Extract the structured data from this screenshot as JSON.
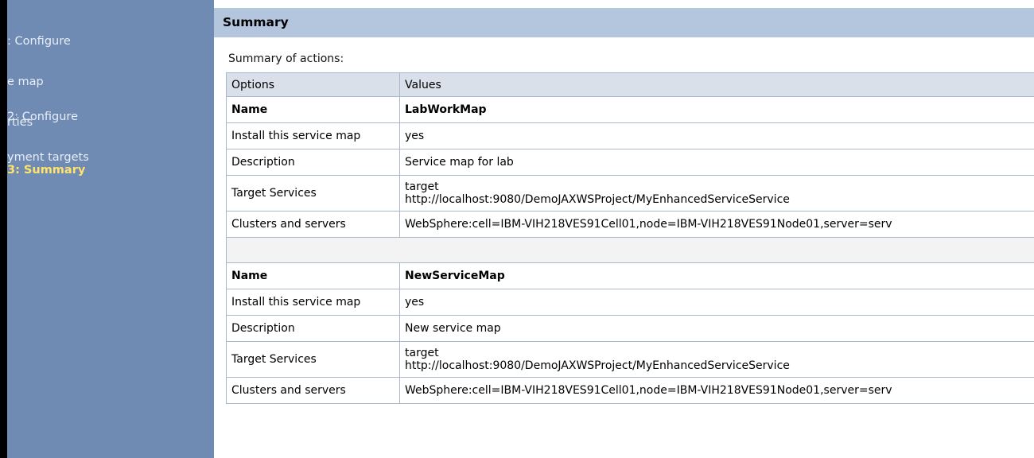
{
  "sidebar": {
    "steps": [
      {
        "line1": ": Configure",
        "line2": "e map",
        "line3": "rties"
      },
      {
        "line1": "2: Configure",
        "line2": "yment targets"
      },
      {
        "line1": "3: Summary"
      }
    ]
  },
  "main": {
    "title": "Summary",
    "caption": "Summary of actions:",
    "table": {
      "headers": [
        "Options",
        "Values"
      ],
      "maps": [
        {
          "name_label": "Name",
          "name": "LabWorkMap",
          "install_label": "Install this service map",
          "install": "yes",
          "description_label": "Description",
          "description": "Service map for lab",
          "targets_label": "Target Services",
          "targets_line1": "target",
          "targets_line2": "http://localhost:9080/DemoJAXWSProject/MyEnhancedServiceService",
          "clusters_label": "Clusters and servers",
          "clusters": "WebSphere:cell=IBM-VIH218VES91Cell01,node=IBM-VIH218VES91Node01,server=serv"
        },
        {
          "name_label": "Name",
          "name": "NewServiceMap",
          "install_label": "Install this service map",
          "install": "yes",
          "description_label": "Description",
          "description": "New service map",
          "targets_label": "Target Services",
          "targets_line1": "target",
          "targets_line2": "http://localhost:9080/DemoJAXWSProject/MyEnhancedServiceService",
          "clusters_label": "Clusters and servers",
          "clusters": "WebSphere:cell=IBM-VIH218VES91Cell01,node=IBM-VIH218VES91Node01,server=serv"
        }
      ]
    }
  },
  "colors": {
    "sidebar_bg": "#6f8ab3",
    "sidebar_current": "#ffe36a",
    "header_bg": "#b4c5de",
    "table_header_bg": "#d9e0ea",
    "table_border": "#a9b7cb"
  }
}
